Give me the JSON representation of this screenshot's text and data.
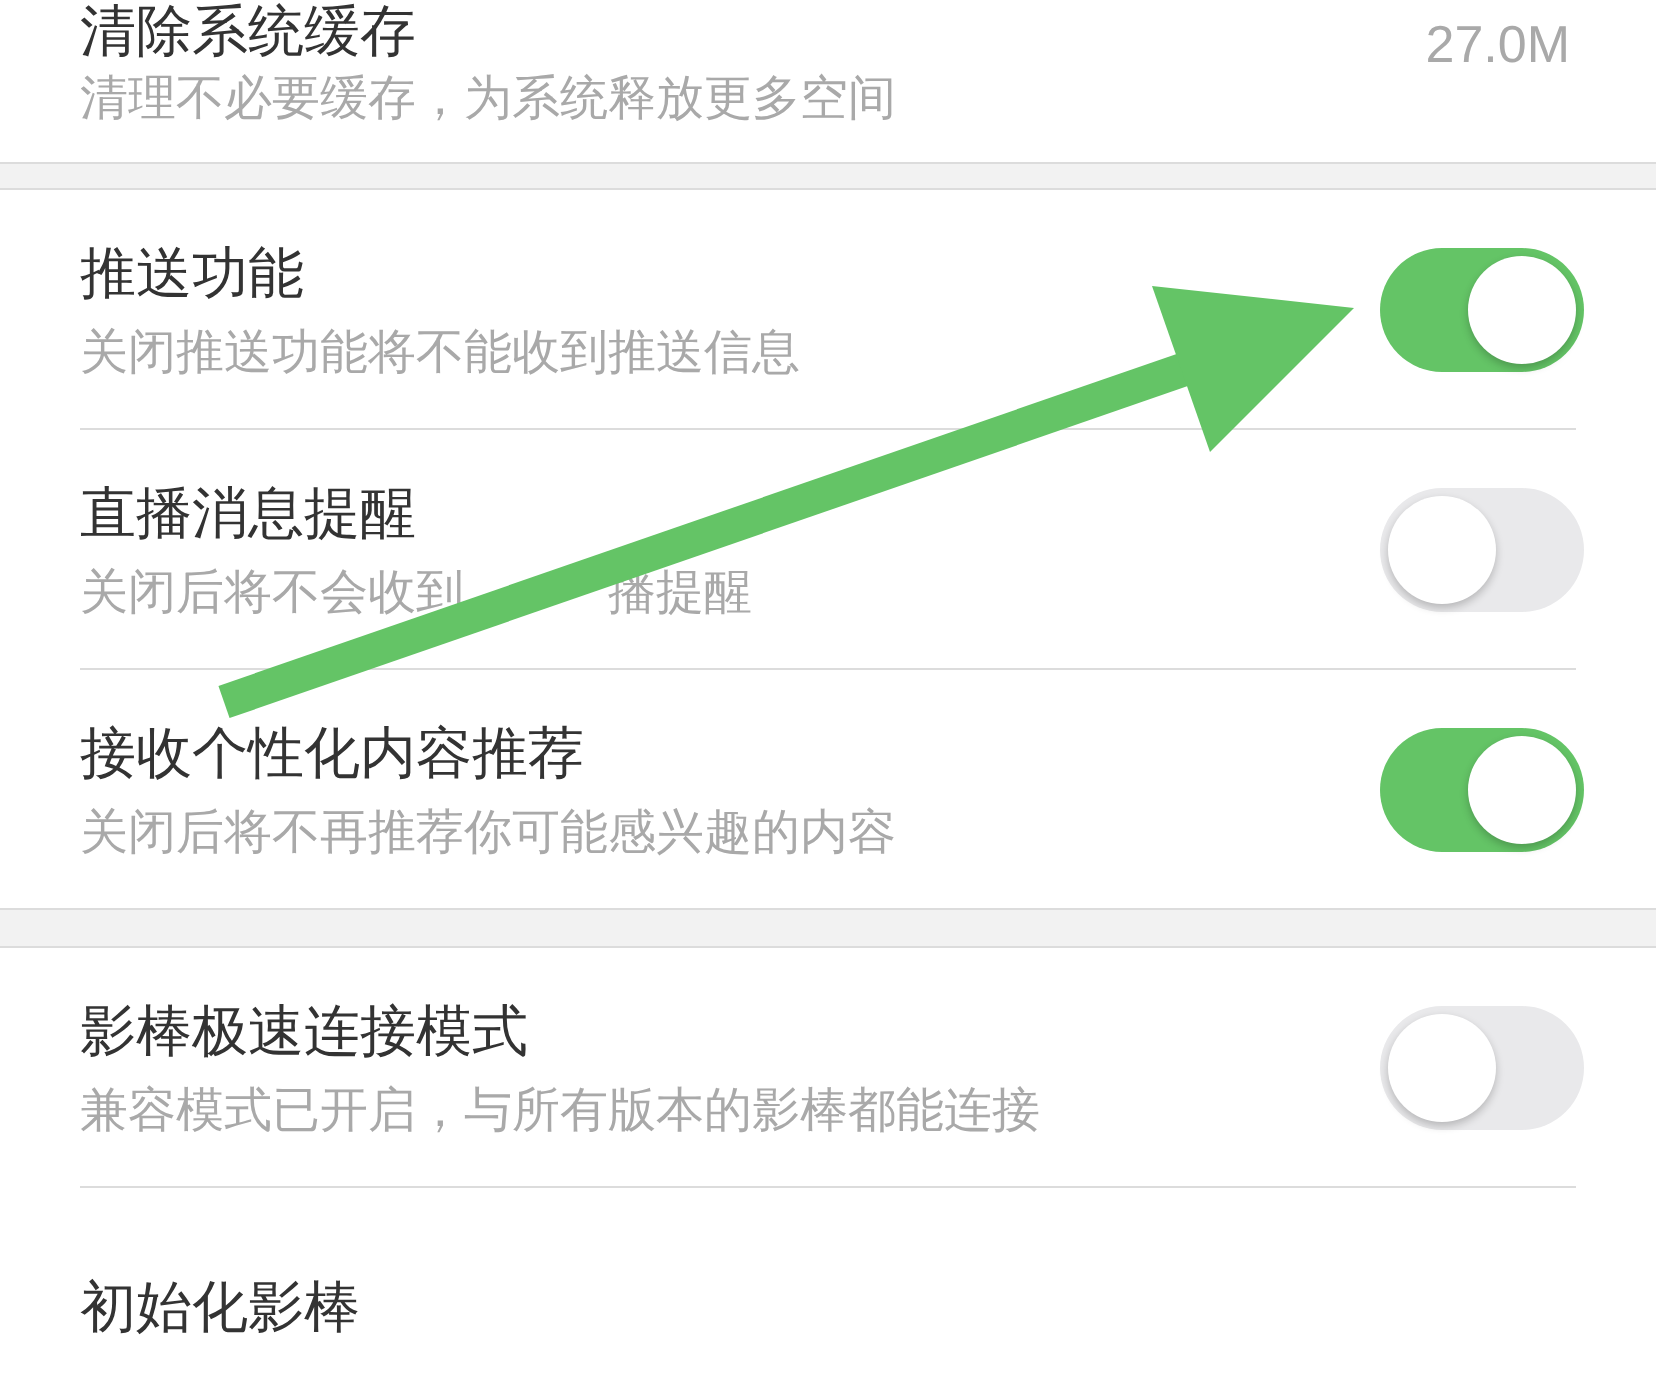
{
  "sections": [
    {
      "items": [
        {
          "kind": "value",
          "title": "清除系统缓存",
          "subtitle": "清理不必要缓存，为系统释放更多空间",
          "value": "27.0M"
        }
      ]
    },
    {
      "items": [
        {
          "kind": "toggle",
          "title": "推送功能",
          "subtitle": "关闭推送功能将不能收到推送信息",
          "on": true
        },
        {
          "kind": "toggle",
          "title": "直播消息提醒",
          "subtitle_parts": [
            "关闭后将不会收到",
            "播提醒"
          ],
          "on": false
        },
        {
          "kind": "toggle",
          "title": "接收个性化内容推荐",
          "subtitle": "关闭后将不再推荐你可能感兴趣的内容",
          "on": true
        }
      ]
    },
    {
      "items": [
        {
          "kind": "toggle",
          "title": "影棒极速连接模式",
          "subtitle": "兼容模式已开启，与所有版本的影棒都能连接",
          "on": false
        },
        {
          "kind": "plain",
          "title": "初始化影棒"
        }
      ]
    }
  ],
  "annotations": [
    {
      "kind": "arrow"
    }
  ]
}
